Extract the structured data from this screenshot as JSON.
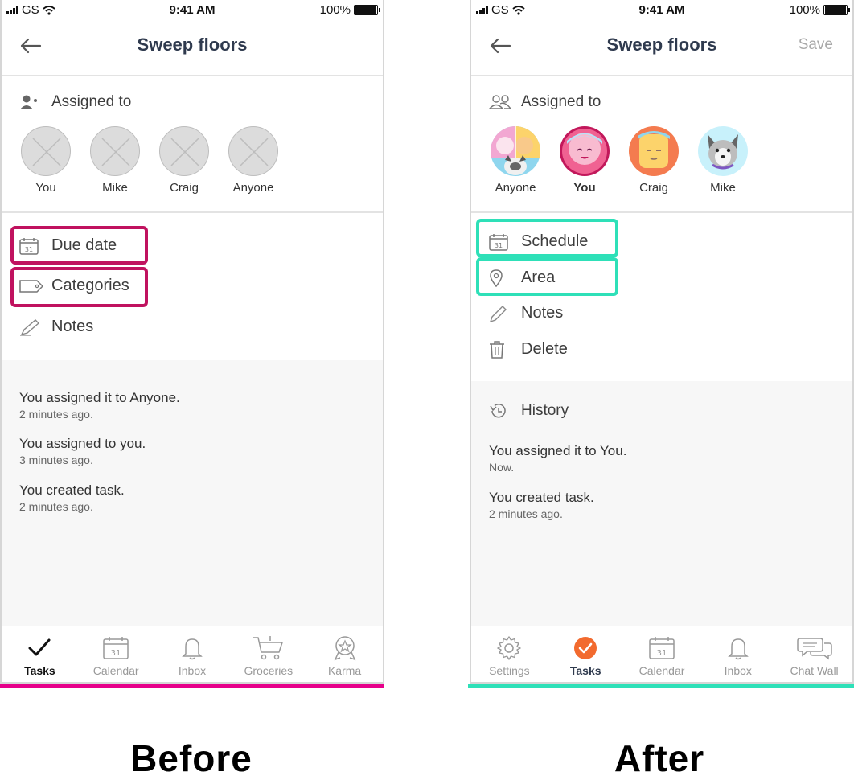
{
  "status_bar": {
    "carrier": "GS",
    "time": "9:41 AM",
    "battery": "100%"
  },
  "before": {
    "title": "Sweep floors",
    "assigned_label": "Assigned to",
    "people": [
      {
        "name": "You"
      },
      {
        "name": "Mike"
      },
      {
        "name": "Craig"
      },
      {
        "name": "Anyone"
      }
    ],
    "options": {
      "due_date": "Due date",
      "categories": "Categories",
      "notes": "Notes"
    },
    "history": [
      {
        "text": "You assigned it to Anyone.",
        "time": "2 minutes ago."
      },
      {
        "text": "You assigned to you.",
        "time": "3 minutes ago."
      },
      {
        "text": "You created task.",
        "time": "2 minutes ago."
      }
    ],
    "tabs": [
      {
        "label": "Tasks",
        "icon": "check-icon"
      },
      {
        "label": "Calendar",
        "icon": "calendar-icon"
      },
      {
        "label": "Inbox",
        "icon": "bell-icon"
      },
      {
        "label": "Groceries",
        "icon": "cart-icon"
      },
      {
        "label": "Karma",
        "icon": "badge-icon"
      }
    ],
    "caption": "Before"
  },
  "after": {
    "title": "Sweep floors",
    "save": "Save",
    "assigned_label": "Assigned to",
    "people": [
      {
        "name": "Anyone"
      },
      {
        "name": "You"
      },
      {
        "name": "Craig"
      },
      {
        "name": "Mike"
      }
    ],
    "options": {
      "schedule": "Schedule",
      "area": "Area",
      "notes": "Notes",
      "delete": "Delete"
    },
    "history_label": "History",
    "history": [
      {
        "text": "You assigned it to You.",
        "time": "Now."
      },
      {
        "text": "You created task.",
        "time": "2 minutes ago."
      }
    ],
    "tabs": [
      {
        "label": "Settings",
        "icon": "gear-icon"
      },
      {
        "label": "Tasks",
        "icon": "check-circle-icon"
      },
      {
        "label": "Calendar",
        "icon": "calendar-icon"
      },
      {
        "label": "Inbox",
        "icon": "bell-icon"
      },
      {
        "label": "Chat Wall",
        "icon": "chat-icon"
      }
    ],
    "caption": "After"
  },
  "colors": {
    "before_accent": "#c0125f",
    "before_underline": "#e6008a",
    "after_accent": "#2ee0b8",
    "active_tab_orange": "#f26a2e"
  }
}
